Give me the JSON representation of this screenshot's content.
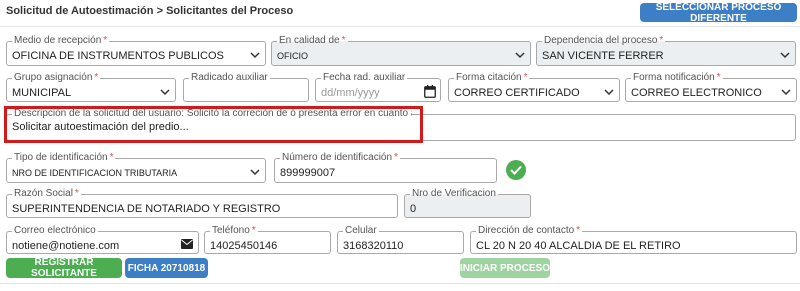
{
  "breadcrumb": {
    "part1": "Solicitud de Autoestimación",
    "separator": ">",
    "part2": "Solicitantes del Proceso"
  },
  "header": {
    "select_process_button": "SELECCIONAR PROCESO DIFERENTE"
  },
  "form": {
    "medio_recepcion": {
      "label": "Medio de recepción",
      "value": "OFICINA DE INSTRUMENTOS PUBLICOS"
    },
    "en_calidad_de": {
      "label": "En calidad de",
      "value": "OFICIO"
    },
    "dependencia": {
      "label": "Dependencia del proceso",
      "value": "SAN VICENTE FERRER"
    },
    "grupo_asignacion": {
      "label": "Grupo asignación",
      "value": "MUNICIPAL"
    },
    "radicado_auxiliar": {
      "label": "Radicado auxiliar",
      "value": ""
    },
    "fecha_rad_auxiliar": {
      "label": "Fecha rad. auxiliar",
      "placeholder": "dd/mm/yyyy"
    },
    "forma_citacion": {
      "label": "Forma citación",
      "value": "CORREO CERTIFICADO"
    },
    "forma_notificacion": {
      "label": "Forma notificación",
      "value": "CORREO ELECTRONICO"
    },
    "descripcion": {
      "label": "Descripción de la solicitud del usuario: Solicitó la correción de ó presenta error en cuanto a...",
      "value": "Solicitar autoestimación del predio..."
    },
    "tipo_identificacion": {
      "label": "Tipo de identificación",
      "value": "NRO DE IDENTIFICACION TRIBUTARIA"
    },
    "numero_identificacion": {
      "label": "Número de identificación",
      "value": "899999007"
    },
    "razon_social": {
      "label": "Razón Social",
      "value": "SUPERINTENDENCIA DE NOTARIADO Y REGISTRO"
    },
    "nro_verificacion": {
      "label": "Nro de Verificacion",
      "value": "0"
    },
    "correo": {
      "label": "Correo electrónico",
      "value": "notiene@notiene.com"
    },
    "telefono": {
      "label": "Teléfono",
      "value": "14025450146"
    },
    "celular": {
      "label": "Celular",
      "value": "3168320110"
    },
    "direccion": {
      "label": "Dirección de contacto",
      "value": "CL 20 N 20 40 ALCALDIA DE EL RETIRO"
    },
    "required_mark": "*"
  },
  "actions": {
    "registrar": "REGISTRAR SOLICITANTE",
    "ficha": "FICHA 20710818",
    "iniciar": "INICIAR PROCESO"
  },
  "icons": {
    "select": "chevron-down-icon",
    "date": "calendar-icon",
    "valid": "check-circle-icon",
    "email": "envelope-icon"
  },
  "colors": {
    "accent_blue": "#3d7fc6",
    "accent_green": "#4cae50",
    "highlight_red": "#d11a1a"
  }
}
